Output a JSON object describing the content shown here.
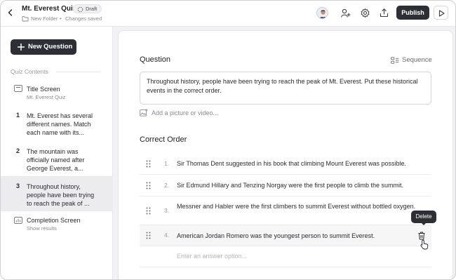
{
  "header": {
    "quiz_title": "Mt. Everest Quiz",
    "status_badge": "Draft",
    "folder": "New Folder",
    "separator": "•",
    "save_status": "Changes saved",
    "publish_label": "Publish",
    "icons": [
      "back-chevron-icon",
      "folder-icon",
      "avatar",
      "add-user-icon",
      "gear-icon",
      "share-icon",
      "play-icon"
    ]
  },
  "sidebar": {
    "new_question_label": "New Question",
    "section_title": "Quiz Contents",
    "items": [
      {
        "num": "",
        "title": "Title Screen",
        "sub": "Mt. Everest Quiz"
      },
      {
        "num": "1",
        "title": "Mt. Everest has several different names. Match each name with its...",
        "sub": ""
      },
      {
        "num": "2",
        "title": "The mountain was officially named after George Everest, a...",
        "sub": ""
      },
      {
        "num": "3",
        "title": "Throughout history, people have been trying to reach the peak of ...",
        "sub": ""
      },
      {
        "num": "",
        "title": "Completion Screen",
        "sub": "Show results"
      }
    ],
    "active_index": 3
  },
  "main": {
    "question_label": "Question",
    "sequence_label": "Sequence",
    "question_text": "Throughout history, people have been trying to reach the peak of Mt. Everest. Put these historical events in the correct order.",
    "add_media_label": "Add a picture or video...",
    "correct_order_label": "Correct Order",
    "answers": [
      {
        "num": "1.",
        "text": "Sir Thomas Dent suggested in his book that climbing Mount Everest was possible."
      },
      {
        "num": "2.",
        "text": "Sir Edmund Hillary and Tenzing Norgay were the first people to climb the summit."
      },
      {
        "num": "3.",
        "text": "Messner and Habler were the first climbers to summit Everest without bottled oxygen."
      },
      {
        "num": "4.",
        "text": "American Jordan Romero was the youngest person to summit Everest."
      }
    ],
    "answer_placeholder": "Enter an answer option...",
    "tooltip": "Delete"
  },
  "colors": {
    "primary_dark": "#2d2f34",
    "active_item_bg": "#ececef",
    "muted_text": "#8a8a92"
  }
}
